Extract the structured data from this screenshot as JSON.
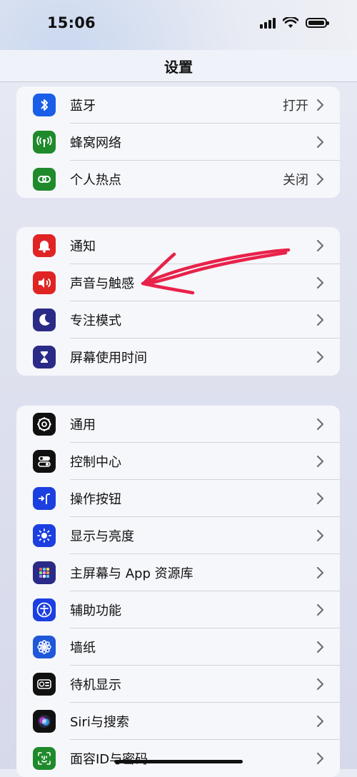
{
  "status_bar": {
    "time": "15:06"
  },
  "nav": {
    "title": "设置"
  },
  "groups": [
    {
      "rows": [
        {
          "label": "蓝牙",
          "value": "打开",
          "icon": "bluetooth-icon",
          "color": "#1b5ee8"
        },
        {
          "label": "蜂窝网络",
          "value": "",
          "icon": "cellular-icon",
          "color": "#1f8a2b"
        },
        {
          "label": "个人热点",
          "value": "关闭",
          "icon": "hotspot-icon",
          "color": "#1f8a2b"
        }
      ]
    },
    {
      "rows": [
        {
          "label": "通知",
          "value": "",
          "icon": "notifications-icon",
          "color": "#e02424"
        },
        {
          "label": "声音与触感",
          "value": "",
          "icon": "sound-icon",
          "color": "#e02424"
        },
        {
          "label": "专注模式",
          "value": "",
          "icon": "focus-moon-icon",
          "color": "#2a2b86"
        },
        {
          "label": "屏幕使用时间",
          "value": "",
          "icon": "hourglass-icon",
          "color": "#2a2b86"
        }
      ]
    },
    {
      "rows": [
        {
          "label": "通用",
          "value": "",
          "icon": "gear-icon",
          "color": "#111111"
        },
        {
          "label": "控制中心",
          "value": "",
          "icon": "toggles-icon",
          "color": "#111111"
        },
        {
          "label": "操作按钮",
          "value": "",
          "icon": "action-button-icon",
          "color": "#1b3fe0"
        },
        {
          "label": "显示与亮度",
          "value": "",
          "icon": "brightness-icon",
          "color": "#1b3fe0"
        },
        {
          "label": "主屏幕与 App 资源库",
          "value": "",
          "icon": "home-screen-grid-icon",
          "color": "#2a2b86"
        },
        {
          "label": "辅助功能",
          "value": "",
          "icon": "accessibility-icon",
          "color": "#1b3fe0"
        },
        {
          "label": "墙纸",
          "value": "",
          "icon": "wallpaper-flower-icon",
          "color": "#1f58d8"
        },
        {
          "label": "待机显示",
          "value": "",
          "icon": "standby-icon",
          "color": "#111111"
        },
        {
          "label": "Siri与搜索",
          "value": "",
          "icon": "siri-icon",
          "color": "#111111"
        },
        {
          "label": "面容ID与密码",
          "value": "",
          "icon": "face-id-icon",
          "color": "#1f8a2b"
        }
      ]
    }
  ],
  "annotation": {
    "color": "#e8224a",
    "icon": "red-hand-drawn-arrow"
  }
}
